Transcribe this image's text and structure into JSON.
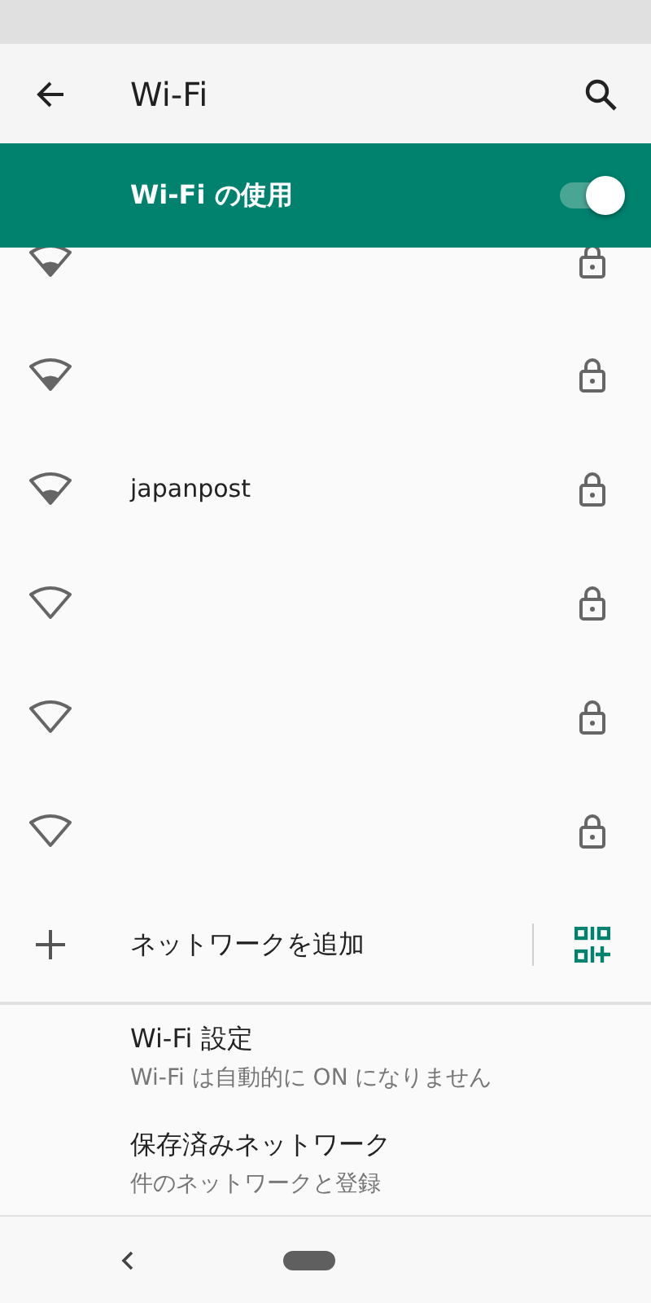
{
  "app_bar": {
    "title": "Wi-Fi"
  },
  "master_switch": {
    "label": "Wi-Fi の使用",
    "on": true
  },
  "networks": [
    {
      "kind": "weak",
      "locked": true
    },
    {
      "kind": "weak",
      "locked": true
    },
    {
      "name": "japanpost",
      "kind": "weak",
      "locked": true
    },
    {
      "kind": "empty",
      "locked": true
    },
    {
      "kind": "empty",
      "locked": true
    },
    {
      "kind": "empty",
      "locked": true
    }
  ],
  "add_network": {
    "label": "ネットワークを追加"
  },
  "settings": [
    {
      "title": "Wi-Fi 設定",
      "subtitle": "Wi-Fi は自動的に ON になりません"
    },
    {
      "title": "保存済みネットワーク",
      "subtitle": "件のネットワークと登録"
    }
  ]
}
